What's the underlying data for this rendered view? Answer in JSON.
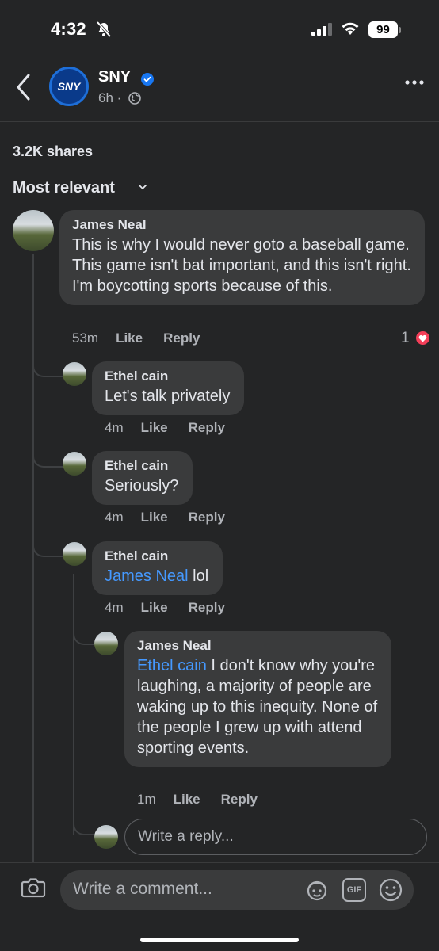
{
  "status_bar": {
    "time": "4:32",
    "battery": "99"
  },
  "header": {
    "page_name": "SNY",
    "post_age": "6h ·",
    "logo_text": "SNY"
  },
  "post": {
    "shares": "3.2K shares"
  },
  "sort": {
    "label": "Most relevant"
  },
  "comments": [
    {
      "author": "James Neal",
      "text": "This is why I would never goto a baseball game. This game isn't bat important, and this isn't right. I'm boycotting sports because of this.",
      "time": "53m",
      "like": "Like",
      "reply": "Reply",
      "reaction_count": "1"
    },
    {
      "author": "Ethel cain",
      "text": "Let's talk privately",
      "time": "4m",
      "like": "Like",
      "reply": "Reply"
    },
    {
      "author": "Ethel cain",
      "text": "Seriously?",
      "time": "4m",
      "like": "Like",
      "reply": "Reply"
    },
    {
      "author": "Ethel cain",
      "mention": "James Neal",
      "text": " lol",
      "time": "4m",
      "like": "Like",
      "reply": "Reply"
    },
    {
      "author": "James Neal",
      "mention": "Ethel cain",
      "text": " I don't know why you're laughing, a majority of people are waking up to this inequity. None of the people I grew up with attend sporting events.",
      "time": "1m",
      "like": "Like",
      "reply": "Reply"
    }
  ],
  "reply_input": {
    "placeholder": "Write a reply..."
  },
  "composer": {
    "placeholder": "Write a comment...",
    "gif_label": "GIF"
  },
  "colors": {
    "mention": "#4599ff",
    "heart": "#f33e58",
    "verified": "#1877f2",
    "background": "#242526",
    "bubble": "#3a3b3c"
  }
}
